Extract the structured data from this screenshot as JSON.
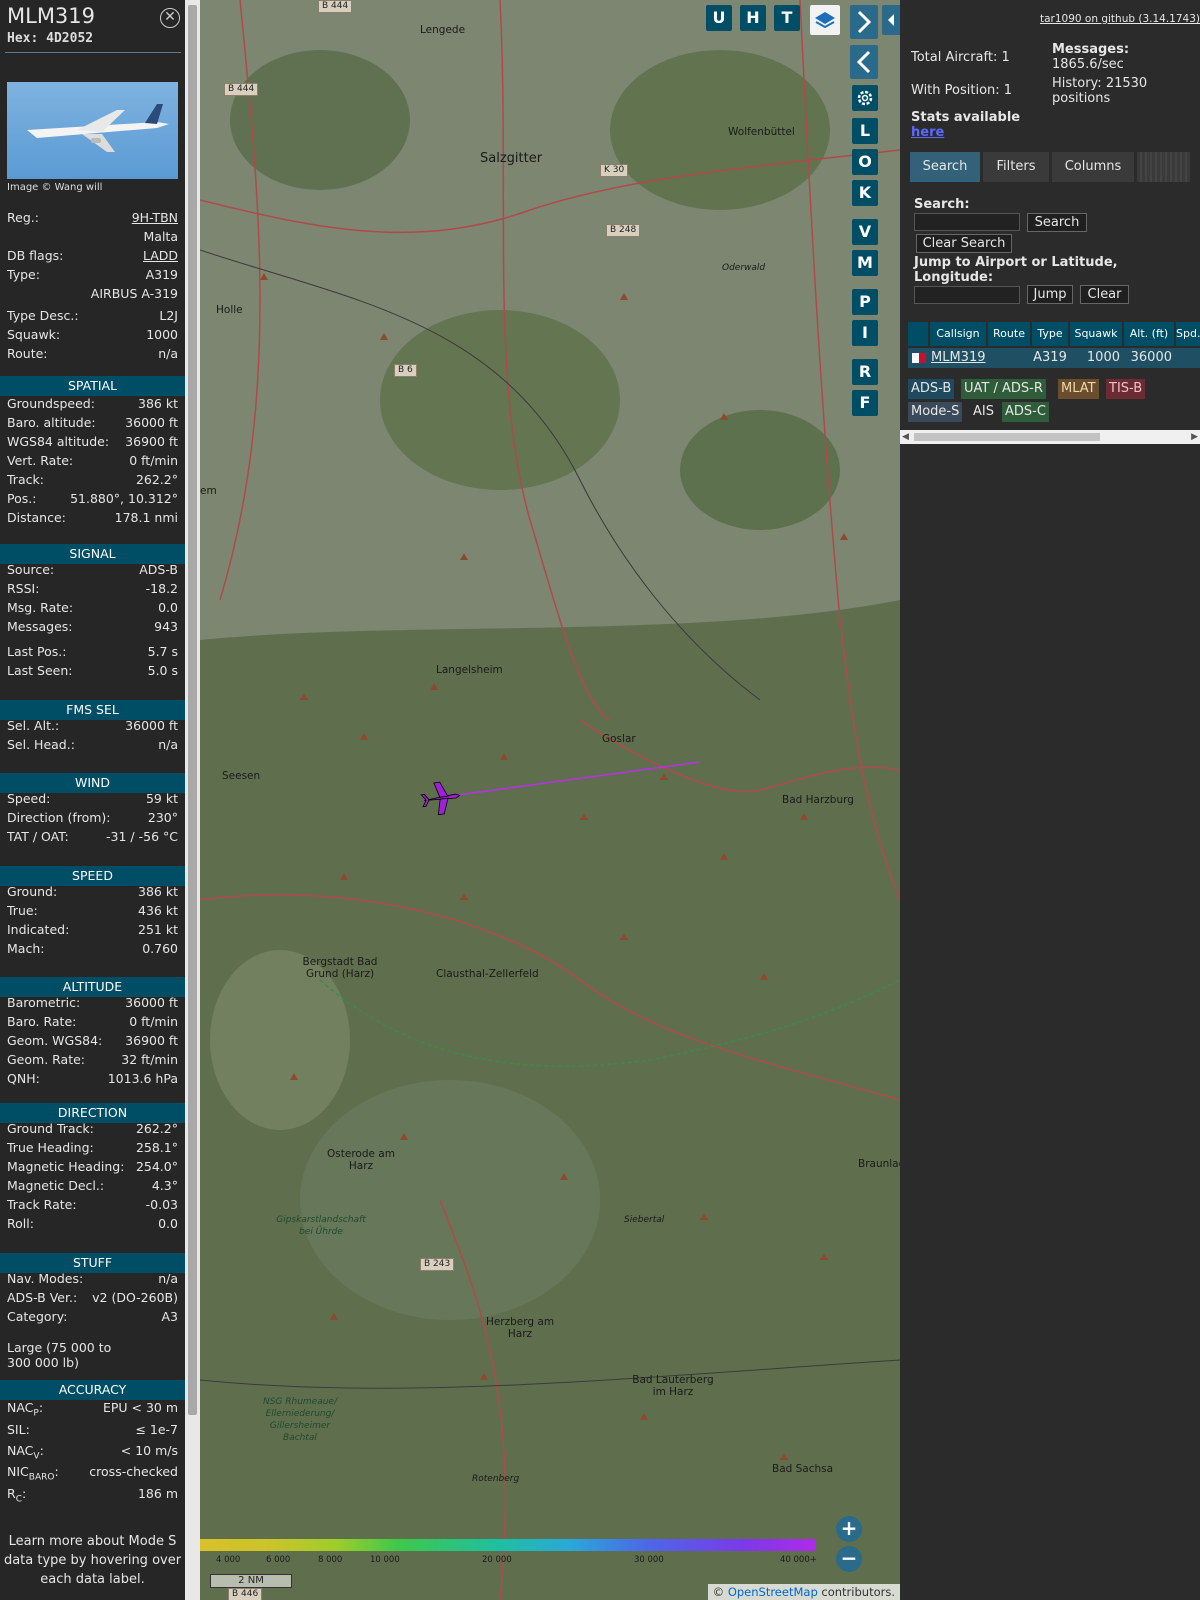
{
  "aircraft": {
    "callsign": "MLM319",
    "hex_label": "Hex:",
    "hex": "4D2052",
    "image_credit": "Image © Wang will"
  },
  "details": [
    {
      "label": "Reg.:",
      "value": "9H-TBN",
      "link": true
    },
    {
      "label": "",
      "value": "Malta"
    },
    {
      "label": "DB flags:",
      "value": "LADD",
      "link": true
    },
    {
      "label": "Type:",
      "value": "A319"
    },
    {
      "label": "",
      "value": "AIRBUS A-319"
    },
    {
      "label": "Type Desc.:",
      "value": "L2J"
    },
    {
      "label": "Squawk:",
      "value": "1000"
    },
    {
      "label": "Route:",
      "value": "n/a"
    }
  ],
  "sections": {
    "spatial": {
      "title": "SPATIAL",
      "rows": [
        [
          "Groundspeed:",
          "386 kt"
        ],
        [
          "Baro. altitude:",
          "36000 ft"
        ],
        [
          "WGS84 altitude:",
          "36900 ft"
        ],
        [
          "Vert. Rate:",
          "0 ft/min"
        ],
        [
          "Track:",
          "262.2°"
        ],
        [
          "Pos.:",
          "51.880°, 10.312°"
        ],
        [
          "Distance:",
          "178.1 nmi"
        ]
      ]
    },
    "signal": {
      "title": "SIGNAL",
      "rows": [
        [
          "Source:",
          "ADS-B"
        ],
        [
          "RSSI:",
          "-18.2"
        ],
        [
          "Msg. Rate:",
          "0.0"
        ],
        [
          "Messages:",
          "943"
        ],
        [
          "Last Pos.:",
          "5.7 s"
        ],
        [
          "Last Seen:",
          "5.0 s"
        ]
      ]
    },
    "fms": {
      "title": "FMS SEL",
      "rows": [
        [
          "Sel. Alt.:",
          "36000 ft"
        ],
        [
          "Sel. Head.:",
          "n/a"
        ]
      ]
    },
    "wind": {
      "title": "WIND",
      "rows": [
        [
          "Speed:",
          "59 kt"
        ],
        [
          "Direction (from):",
          "230°"
        ],
        [
          "TAT / OAT:",
          "-31 / -56 °C"
        ]
      ]
    },
    "speed": {
      "title": "SPEED",
      "rows": [
        [
          "Ground:",
          "386 kt"
        ],
        [
          "True:",
          "436 kt"
        ],
        [
          "Indicated:",
          "251 kt"
        ],
        [
          "Mach:",
          "0.760"
        ]
      ]
    },
    "altitude": {
      "title": "ALTITUDE",
      "rows": [
        [
          "Barometric:",
          "36000 ft"
        ],
        [
          "Baro. Rate:",
          "0 ft/min"
        ],
        [
          "Geom. WGS84:",
          "36900 ft"
        ],
        [
          "Geom. Rate:",
          "32 ft/min"
        ],
        [
          "QNH:",
          "1013.6 hPa"
        ]
      ]
    },
    "direction": {
      "title": "DIRECTION",
      "rows": [
        [
          "Ground Track:",
          "262.2°"
        ],
        [
          "True Heading:",
          "258.1°"
        ],
        [
          "Magnetic Heading:",
          "254.0°"
        ],
        [
          "Magnetic Decl.:",
          "4.3°"
        ],
        [
          "Track Rate:",
          "-0.03"
        ],
        [
          "Roll:",
          "0.0"
        ]
      ]
    },
    "stuff": {
      "title": "STUFF",
      "rows": [
        [
          "Nav. Modes:",
          "n/a"
        ],
        [
          "ADS-B Ver.:",
          "v2 (DO-260B)"
        ],
        [
          "Category:",
          "A3"
        ]
      ],
      "category_desc": "Large (75 000 to 300 000 lb)"
    },
    "accuracy": {
      "title": "ACCURACY",
      "rows": [
        [
          "NAC",
          "P",
          ":",
          "EPU < 30 m"
        ],
        [
          "SIL:",
          "",
          "",
          "≤ 1e-7"
        ],
        [
          "NAC",
          "V",
          ":",
          "< 10 m/s"
        ],
        [
          "NIC",
          "BARO",
          ":",
          "cross-checked"
        ],
        [
          "R",
          "C",
          ":",
          "186 m"
        ]
      ]
    }
  },
  "learn_more": "Learn more about Mode S data type by hovering over each data label.",
  "map": {
    "buttons": [
      "U",
      "H",
      "T",
      "L",
      "O",
      "K",
      "V",
      "M",
      "P",
      "I",
      "R",
      "F"
    ],
    "places": [
      "Lengede",
      "Salzgitter",
      "Wolfenbüttel",
      "Holle",
      "Langelsheim",
      "Goslar",
      "Seesen",
      "Bad Harzburg",
      "Bergstadt Bad Grund (Harz)",
      "Clausthal-Zellerfeld",
      "Osterode am Harz",
      "Herzberg am Harz",
      "Bad Lauterberg im Harz",
      "Bad Sachsa",
      "Braunlag",
      "Oderwald",
      "Siebertal",
      "Gipskarstlandschaft bei Ührde",
      "NSG Rhumeaue/ Ellerniederung/ Gillersheimer Bachtal",
      "Rotenberg",
      "em"
    ],
    "roads": [
      "B 444",
      "B 444",
      "K 30",
      "B 248",
      "B 6",
      "B 243",
      "B 446"
    ],
    "scale_label": "2 NM",
    "altitude_ticks": [
      "4 000",
      "6 000",
      "8 000",
      "10 000",
      "20 000",
      "30 000",
      "40 000+"
    ],
    "attribution_prefix": "© ",
    "attribution_link": "OpenStreetMap",
    "attribution_suffix": " contributors."
  },
  "panel": {
    "github": "tar1090 on github (3.14.1743)",
    "total_aircraft": "Total Aircraft: 1",
    "with_position": "With Position: 1",
    "messages_label": "Messages:",
    "messages_value": "1865.6/sec",
    "history_label": "History: 21530",
    "history_value": "positions",
    "stats_label": "Stats available",
    "stats_link": "here",
    "tabs": [
      "Search",
      "Filters",
      "Columns"
    ],
    "search_label": "Search:",
    "search_button": "Search",
    "clear_search": "Clear Search",
    "jump_label": "Jump to Airport or Latitude, Longitude:",
    "jump_button": "Jump",
    "clear_button": "Clear",
    "table_headers": [
      "Callsign",
      "Route",
      "Type",
      "Squawk",
      "Alt. (ft)",
      "Spd."
    ],
    "table_row": {
      "callsign": "MLM319",
      "route": "",
      "type": "A319",
      "squawk": "1000",
      "alt": "36000"
    },
    "sources": [
      {
        "label": "ADS-B",
        "color": "#1e4a5f"
      },
      {
        "label": "UAT / ADS-R",
        "color": "#2f5d3a"
      },
      {
        "label": "MLAT",
        "color": "#6b4e2e"
      },
      {
        "label": "TIS-B",
        "color": "#6b2b33"
      },
      {
        "label": "Mode-S",
        "color": "#3a4a5a"
      },
      {
        "label": "AIS",
        "color": "#2b2b2b"
      },
      {
        "label": "ADS-C",
        "color": "#2f5d3a"
      }
    ]
  }
}
